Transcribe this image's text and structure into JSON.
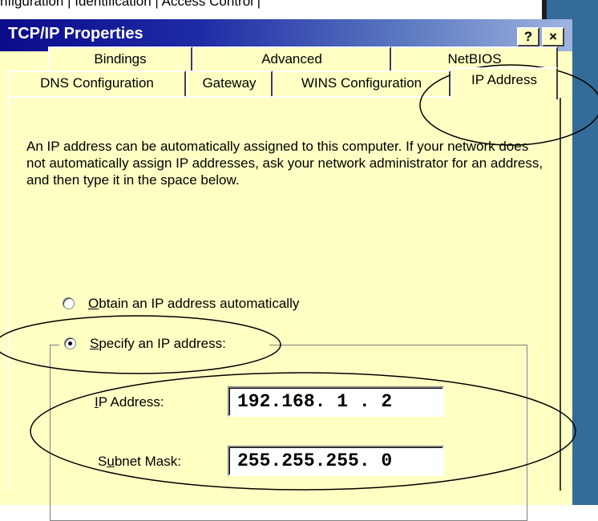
{
  "behind_window": {
    "tabs_text": "nfiguration | Identification | Access Control |"
  },
  "window": {
    "title": "TCP/IP Properties",
    "help_label": "?",
    "close_label": "×"
  },
  "tabs": {
    "back_row": [
      "Bindings",
      "Advanced",
      "NetBIOS"
    ],
    "front_row": [
      "DNS Configuration",
      "Gateway",
      "WINS Configuration"
    ],
    "active": "IP Address"
  },
  "description": "An IP address can be automatically assigned to this computer. If your network does not automatically assign IP addresses, ask your network administrator for an address, and then type it in the space below.",
  "options": {
    "auto": {
      "prefix": "",
      "accel": "O",
      "rest": "btain an IP address automatically",
      "selected": false
    },
    "specify": {
      "prefix": "",
      "accel": "S",
      "rest": "pecify an IP address:",
      "selected": true
    }
  },
  "fields": {
    "ip_address": {
      "accel": "I",
      "rest": "P Address:",
      "value": "192.168. 1 . 2"
    },
    "subnet_mask": {
      "prefix": "S",
      "accel": "u",
      "rest": "bnet Mask:",
      "value": "255.255.255. 0"
    }
  },
  "colors": {
    "dialog_bg": "#ffffc4",
    "title_start": "#0b0b8c",
    "desktop": "#336b99"
  }
}
